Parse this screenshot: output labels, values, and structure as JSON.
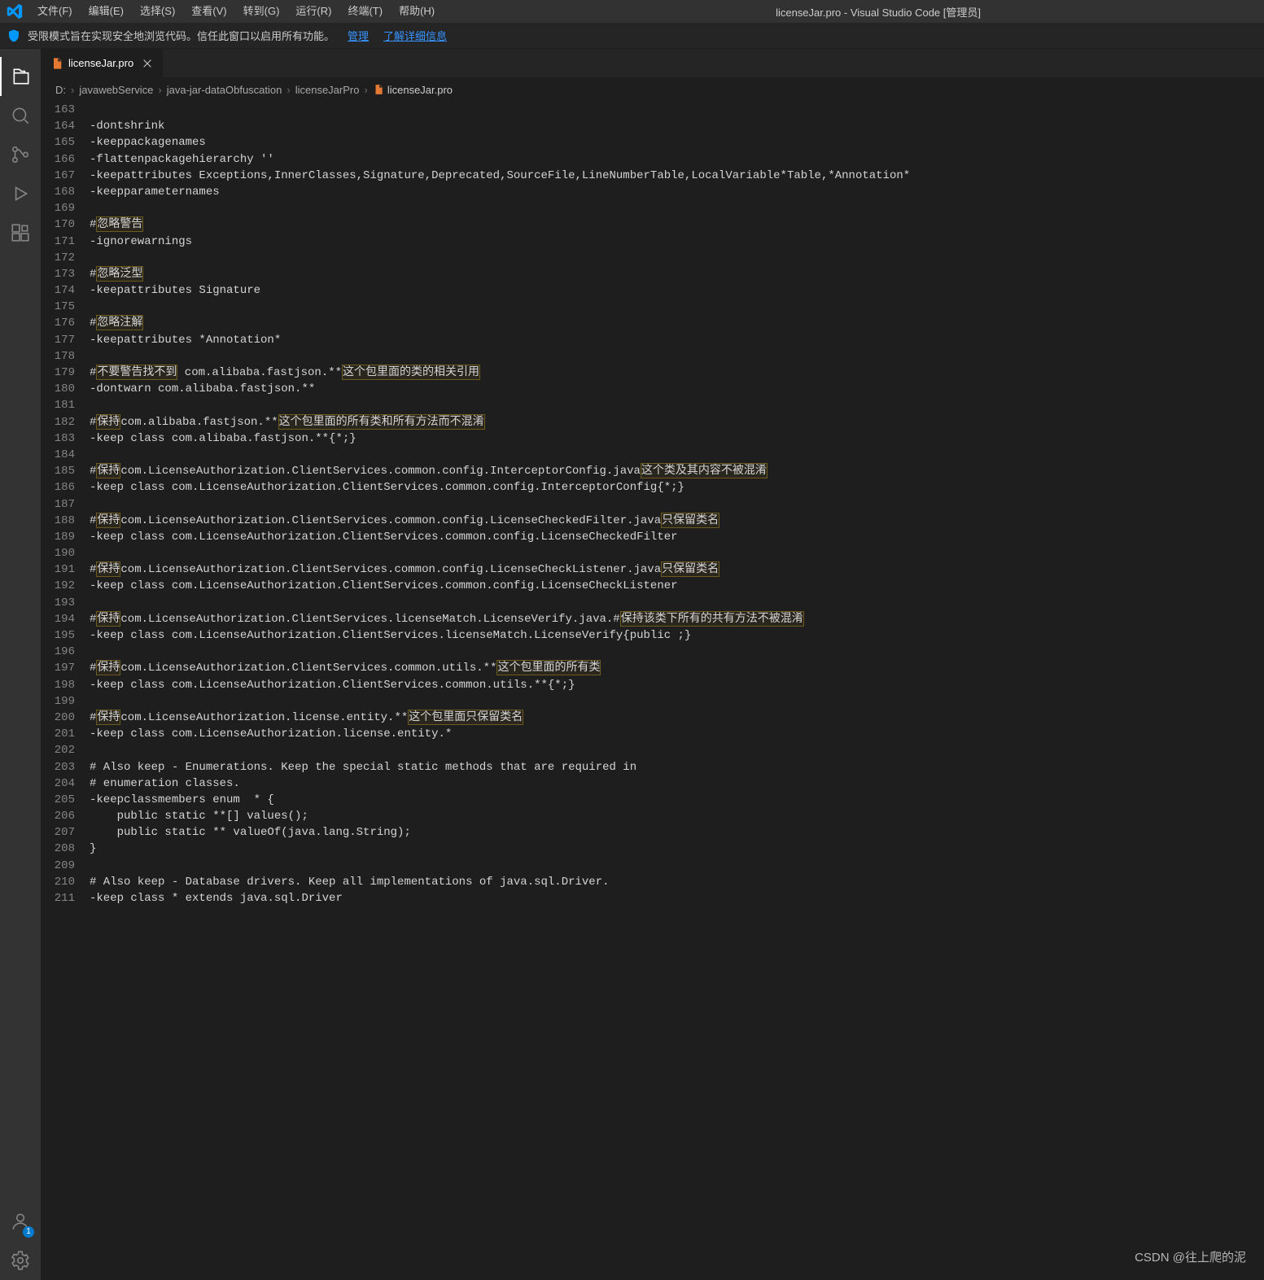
{
  "title": "licenseJar.pro - Visual Studio Code [管理员]",
  "menu": [
    "文件(F)",
    "编辑(E)",
    "选择(S)",
    "查看(V)",
    "转到(G)",
    "运行(R)",
    "终端(T)",
    "帮助(H)"
  ],
  "notif": {
    "text": "受限模式旨在实现安全地浏览代码。信任此窗口以启用所有功能。",
    "manage": "管理",
    "learn": "了解详细信息"
  },
  "tab": {
    "name": "licenseJar.pro"
  },
  "breadcrumbs": {
    "parts": [
      "D:",
      "javawebService",
      "java-jar-dataObfuscation",
      "licenseJarPro"
    ],
    "file": "licenseJar.pro"
  },
  "account_badge": "1",
  "watermark": "CSDN @往上爬的泥",
  "first_line_no": 163,
  "lines": [
    {
      "t": ""
    },
    {
      "t": "-dontshrink"
    },
    {
      "t": "-keeppackagenames"
    },
    {
      "t": "-flattenpackagehierarchy ''"
    },
    {
      "t": "-keepattributes Exceptions,InnerClasses,Signature,Deprecated,SourceFile,LineNumberTable,LocalVariable*Table,*Annotation*"
    },
    {
      "t": "-keepparameternames"
    },
    {
      "t": ""
    },
    {
      "seg": [
        {
          "s": "#"
        },
        {
          "s": "忽略警告",
          "h": true
        }
      ]
    },
    {
      "t": "-ignorewarnings"
    },
    {
      "t": ""
    },
    {
      "seg": [
        {
          "s": "#"
        },
        {
          "s": "忽略泛型",
          "h": true
        }
      ]
    },
    {
      "t": "-keepattributes Signature"
    },
    {
      "t": ""
    },
    {
      "seg": [
        {
          "s": "#"
        },
        {
          "s": "忽略注解",
          "h": true
        }
      ]
    },
    {
      "t": "-keepattributes *Annotation*"
    },
    {
      "t": ""
    },
    {
      "seg": [
        {
          "s": "#"
        },
        {
          "s": "不要警告找不到",
          "h": true
        },
        {
          "s": " com.alibaba.fastjson.**"
        },
        {
          "s": "这个包里面的类的相关引用",
          "h": true
        }
      ]
    },
    {
      "t": "-dontwarn com.alibaba.fastjson.**"
    },
    {
      "t": ""
    },
    {
      "seg": [
        {
          "s": "#"
        },
        {
          "s": "保持",
          "h": true
        },
        {
          "s": "com.alibaba.fastjson.**"
        },
        {
          "s": "这个包里面的所有类和所有方法而不混淆",
          "h": true
        }
      ]
    },
    {
      "t": "-keep class com.alibaba.fastjson.**{*;}"
    },
    {
      "t": ""
    },
    {
      "seg": [
        {
          "s": "#"
        },
        {
          "s": "保持",
          "h": true
        },
        {
          "s": "com.LicenseAuthorization.ClientServices.common.config.InterceptorConfig.java"
        },
        {
          "s": "这个类及其内容不被混淆",
          "h": true
        }
      ]
    },
    {
      "t": "-keep class com.LicenseAuthorization.ClientServices.common.config.InterceptorConfig{*;}"
    },
    {
      "t": ""
    },
    {
      "seg": [
        {
          "s": "#"
        },
        {
          "s": "保持",
          "h": true
        },
        {
          "s": "com.LicenseAuthorization.ClientServices.common.config.LicenseCheckedFilter.java"
        },
        {
          "s": "只保留类名",
          "h": true
        }
      ]
    },
    {
      "t": "-keep class com.LicenseAuthorization.ClientServices.common.config.LicenseCheckedFilter"
    },
    {
      "t": ""
    },
    {
      "seg": [
        {
          "s": "#"
        },
        {
          "s": "保持",
          "h": true
        },
        {
          "s": "com.LicenseAuthorization.ClientServices.common.config.LicenseCheckListener.java"
        },
        {
          "s": "只保留类名",
          "h": true
        }
      ]
    },
    {
      "t": "-keep class com.LicenseAuthorization.ClientServices.common.config.LicenseCheckListener"
    },
    {
      "t": ""
    },
    {
      "seg": [
        {
          "s": "#"
        },
        {
          "s": "保持",
          "h": true
        },
        {
          "s": "com.LicenseAuthorization.ClientServices.licenseMatch.LicenseVerify.java.#"
        },
        {
          "s": "保持该类下所有的共有方法不被混淆",
          "h": true
        }
      ]
    },
    {
      "t": "-keep class com.LicenseAuthorization.ClientServices.licenseMatch.LicenseVerify{public ;}"
    },
    {
      "t": ""
    },
    {
      "seg": [
        {
          "s": "#"
        },
        {
          "s": "保持",
          "h": true
        },
        {
          "s": "com.LicenseAuthorization.ClientServices.common.utils.**"
        },
        {
          "s": "这个包里面的所有类",
          "h": true
        }
      ]
    },
    {
      "t": "-keep class com.LicenseAuthorization.ClientServices.common.utils.**{*;}"
    },
    {
      "t": ""
    },
    {
      "seg": [
        {
          "s": "#"
        },
        {
          "s": "保持",
          "h": true
        },
        {
          "s": "com.LicenseAuthorization.license.entity.**"
        },
        {
          "s": "这个包里面只保留类名",
          "h": true
        }
      ]
    },
    {
      "t": "-keep class com.LicenseAuthorization.license.entity.*"
    },
    {
      "t": ""
    },
    {
      "t": "# Also keep - Enumerations. Keep the special static methods that are required in"
    },
    {
      "t": "# enumeration classes."
    },
    {
      "t": "-keepclassmembers enum  * {"
    },
    {
      "t": "    public static **[] values();"
    },
    {
      "t": "    public static ** valueOf(java.lang.String);"
    },
    {
      "t": "}"
    },
    {
      "t": ""
    },
    {
      "t": "# Also keep - Database drivers. Keep all implementations of java.sql.Driver."
    },
    {
      "t": "-keep class * extends java.sql.Driver"
    }
  ]
}
